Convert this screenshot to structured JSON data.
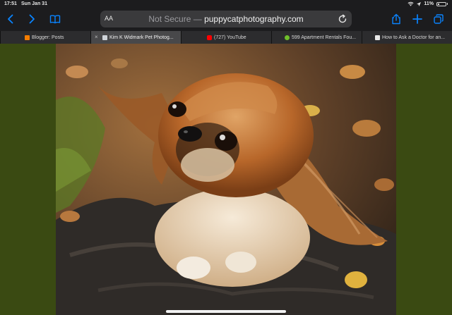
{
  "status_bar": {
    "time": "17:51",
    "date": "Sun Jan 31",
    "battery": "11%"
  },
  "toolbar": {
    "back_icon": "chevron-left-icon",
    "forward_icon": "chevron-right-icon",
    "reader_icon": "book-icon",
    "aa_label": "AA",
    "url_prefix": "Not Secure —",
    "url_host": "puppycatphotography.com",
    "reload_icon": "reload-icon",
    "share_icon": "share-icon",
    "new_tab_icon": "plus-icon",
    "tabs_icon": "tabs-overview-icon"
  },
  "tabs": [
    {
      "title": "Blogger: Posts",
      "favicon_color": "#f57d00"
    },
    {
      "title": "Kim K Widmark Pet Photog...",
      "favicon_color": "#cfd3d8",
      "active": true
    },
    {
      "title": "(727) YouTube",
      "favicon_color": "#ff0000"
    },
    {
      "title": "599 Apartment Rentals Fou...",
      "favicon_color": "#6fbf2a"
    },
    {
      "title": "How to Ask a Doctor for an...",
      "favicon_color": "#e8e8e8"
    }
  ],
  "colors": {
    "page_background": "#3a4a12",
    "chrome_background": "#1c1c1e",
    "url_field": "#3a3a3c",
    "accent_blue": "#0a84ff"
  },
  "content": {
    "image_subject": "pekingese-dog-photo"
  }
}
